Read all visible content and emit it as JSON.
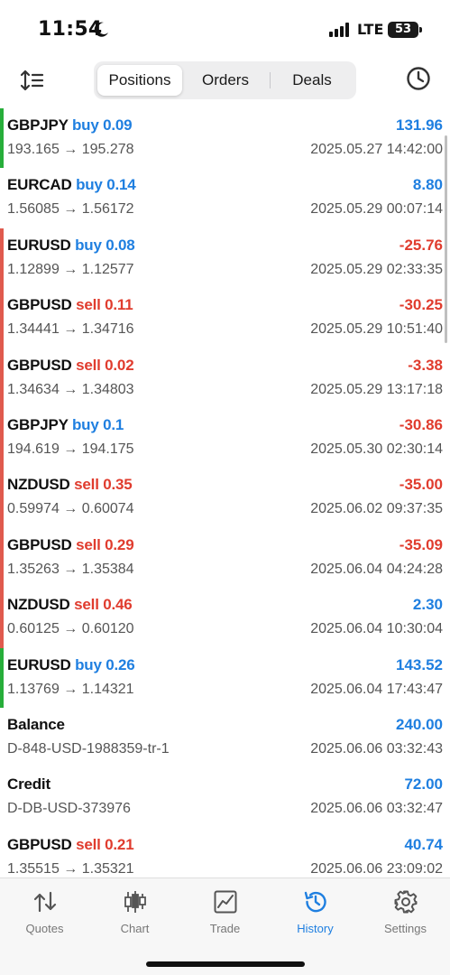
{
  "status_bar": {
    "time": "11:54",
    "network": "LTE",
    "battery": "53"
  },
  "header": {
    "tabs": [
      {
        "label": "Positions",
        "active": true
      },
      {
        "label": "Orders",
        "active": false
      },
      {
        "label": "Deals",
        "active": false
      }
    ]
  },
  "colors": {
    "accent": "#1f7fe0",
    "loss": "#e03c2e",
    "buy_bar": "#27ae3a",
    "sell_bar": "#e05a4e"
  },
  "rows": [
    {
      "symbol": "GBPJPY",
      "direction": "buy 0.09",
      "dir_type": "buy",
      "prices": "193.165 → 195.278",
      "pl": "131.96",
      "pl_type": "profit",
      "time": "2025.05.27 14:42:00",
      "bar": "buy"
    },
    {
      "symbol": "EURCAD",
      "direction": "buy 0.14",
      "dir_type": "buy",
      "prices": "1.56085 → 1.56172",
      "pl": "8.80",
      "pl_type": "profit",
      "time": "2025.05.29 00:07:14",
      "bar": "none"
    },
    {
      "symbol": "EURUSD",
      "direction": "buy 0.08",
      "dir_type": "buy",
      "prices": "1.12899 → 1.12577",
      "pl": "-25.76",
      "pl_type": "loss",
      "time": "2025.05.29 02:33:35",
      "bar": "sell"
    },
    {
      "symbol": "GBPUSD",
      "direction": "sell 0.11",
      "dir_type": "sell",
      "prices": "1.34441 → 1.34716",
      "pl": "-30.25",
      "pl_type": "loss",
      "time": "2025.05.29 10:51:40",
      "bar": "sell"
    },
    {
      "symbol": "GBPUSD",
      "direction": "sell 0.02",
      "dir_type": "sell",
      "prices": "1.34634 → 1.34803",
      "pl": "-3.38",
      "pl_type": "loss",
      "time": "2025.05.29 13:17:18",
      "bar": "sell"
    },
    {
      "symbol": "GBPJPY",
      "direction": "buy 0.1",
      "dir_type": "buy",
      "prices": "194.619 → 194.175",
      "pl": "-30.86",
      "pl_type": "loss",
      "time": "2025.05.30 02:30:14",
      "bar": "sell"
    },
    {
      "symbol": "NZDUSD",
      "direction": "sell 0.35",
      "dir_type": "sell",
      "prices": "0.59974 → 0.60074",
      "pl": "-35.00",
      "pl_type": "loss",
      "time": "2025.06.02 09:37:35",
      "bar": "sell"
    },
    {
      "symbol": "GBPUSD",
      "direction": "sell 0.29",
      "dir_type": "sell",
      "prices": "1.35263 → 1.35384",
      "pl": "-35.09",
      "pl_type": "loss",
      "time": "2025.06.04 04:24:28",
      "bar": "sell"
    },
    {
      "symbol": "NZDUSD",
      "direction": "sell 0.46",
      "dir_type": "sell",
      "prices": "0.60125 → 0.60120",
      "pl": "2.30",
      "pl_type": "profit",
      "time": "2025.06.04 10:30:04",
      "bar": "sell"
    },
    {
      "symbol": "EURUSD",
      "direction": "buy 0.26",
      "dir_type": "buy",
      "prices": "1.13769 → 1.14321",
      "pl": "143.52",
      "pl_type": "profit",
      "time": "2025.06.04 17:43:47",
      "bar": "buy"
    },
    {
      "symbol": "Balance",
      "direction": "",
      "dir_type": "none",
      "prices": "D-848-USD-1988359-tr-1",
      "pl": "240.00",
      "pl_type": "profit",
      "time": "2025.06.06 03:32:43",
      "bar": "none"
    },
    {
      "symbol": "Credit",
      "direction": "",
      "dir_type": "none",
      "prices": "D-DB-USD-373976",
      "pl": "72.00",
      "pl_type": "profit",
      "time": "2025.06.06 03:32:47",
      "bar": "none"
    },
    {
      "symbol": "GBPUSD",
      "direction": "sell 0.21",
      "dir_type": "sell",
      "prices": "1.35515 → 1.35321",
      "pl": "40.74",
      "pl_type": "profit",
      "time": "2025.06.06 23:09:02",
      "bar": "none"
    }
  ],
  "tabbar": {
    "items": [
      {
        "label": "Quotes",
        "icon": "quotes-icon",
        "active": false
      },
      {
        "label": "Chart",
        "icon": "candlestick-icon",
        "active": false
      },
      {
        "label": "Trade",
        "icon": "trade-chart-icon",
        "active": false
      },
      {
        "label": "History",
        "icon": "history-icon",
        "active": true
      },
      {
        "label": "Settings",
        "icon": "gear-icon",
        "active": false
      }
    ]
  }
}
